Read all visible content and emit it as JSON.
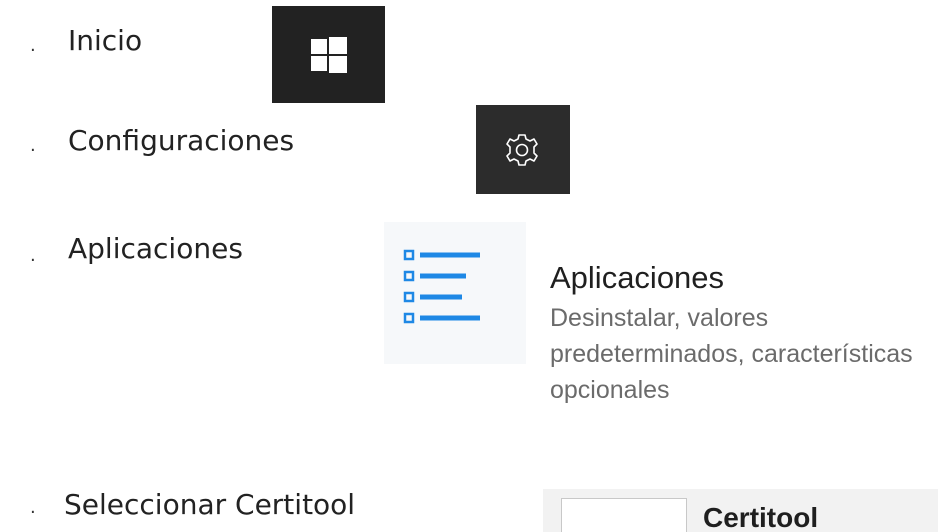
{
  "steps": [
    {
      "bullet": "·",
      "label": "Inicio"
    },
    {
      "bullet": "·",
      "label": "Configuraciones"
    },
    {
      "bullet": "·",
      "label": "Aplicaciones"
    },
    {
      "bullet": "·",
      "label": "Seleccionar Certitool"
    }
  ],
  "apps_card": {
    "title": "Aplicaciones",
    "description": "Desinstalar, valores predeterminados, características opcionales"
  },
  "certitool_item": {
    "label": "Certitool"
  },
  "icons": {
    "start": "windows-logo-icon",
    "settings": "gear-icon",
    "apps": "apps-list-icon"
  },
  "colors": {
    "tile_dark": "#222222",
    "accent_blue": "#1e88e5"
  }
}
